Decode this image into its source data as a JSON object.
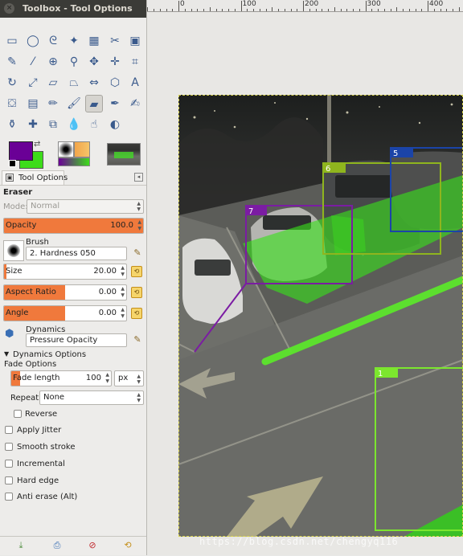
{
  "window": {
    "title": "Toolbox - Tool Options",
    "close_glyph": "×"
  },
  "tools": [
    {
      "icon": "rect-select-icon",
      "glyph": "▭"
    },
    {
      "icon": "ellipse-select-icon",
      "glyph": "◯"
    },
    {
      "icon": "free-select-icon",
      "glyph": "ᘓ"
    },
    {
      "icon": "fuzzy-select-icon",
      "glyph": "✦"
    },
    {
      "icon": "color-select-icon",
      "glyph": "▦"
    },
    {
      "icon": "scissors-icon",
      "glyph": "✂"
    },
    {
      "icon": "foreground-select-icon",
      "glyph": "▣"
    },
    {
      "icon": "paths-icon",
      "glyph": "✎"
    },
    {
      "icon": "color-picker-icon",
      "glyph": "⁄"
    },
    {
      "icon": "zoom-icon",
      "glyph": "⊕"
    },
    {
      "icon": "measure-icon",
      "glyph": "⚲"
    },
    {
      "icon": "move-icon",
      "glyph": "✥"
    },
    {
      "icon": "align-icon",
      "glyph": "✛"
    },
    {
      "icon": "crop-icon",
      "glyph": "⌗"
    },
    {
      "icon": "rotate-icon",
      "glyph": "↻"
    },
    {
      "icon": "scale-icon",
      "glyph": "⤢"
    },
    {
      "icon": "shear-icon",
      "glyph": "▱"
    },
    {
      "icon": "perspective-icon",
      "glyph": "⏢"
    },
    {
      "icon": "flip-icon",
      "glyph": "⇔"
    },
    {
      "icon": "cage-icon",
      "glyph": "⬡"
    },
    {
      "icon": "text-icon",
      "glyph": "A"
    },
    {
      "icon": "bucket-fill-icon",
      "glyph": "⛋"
    },
    {
      "icon": "blend-icon",
      "glyph": "▤"
    },
    {
      "icon": "pencil-icon",
      "glyph": "✏"
    },
    {
      "icon": "paintbrush-icon",
      "glyph": "🖌"
    },
    {
      "icon": "eraser-icon",
      "glyph": "▰"
    },
    {
      "icon": "airbrush-icon",
      "glyph": "✒"
    },
    {
      "icon": "ink-icon",
      "glyph": "✍"
    },
    {
      "icon": "clone-icon",
      "glyph": "⚱"
    },
    {
      "icon": "heal-icon",
      "glyph": "✚"
    },
    {
      "icon": "perspective-clone-icon",
      "glyph": "⧉"
    },
    {
      "icon": "blur-icon",
      "glyph": "💧"
    },
    {
      "icon": "smudge-icon",
      "glyph": "☝"
    },
    {
      "icon": "dodge-burn-icon",
      "glyph": "◐"
    }
  ],
  "colors": {
    "foreground": "#6a0096",
    "background": "#3ddc1a",
    "accent": "#f0793c"
  },
  "tab": {
    "label": "Tool Options",
    "menu_glyph": "◂"
  },
  "options": {
    "tool_name": "Eraser",
    "mode_label": "Mode:",
    "mode_value": "Normal",
    "opacity": {
      "label": "Opacity",
      "value": "100.0",
      "fraction": 1.0
    },
    "brush": {
      "label": "Brush",
      "value": "2. Hardness 050"
    },
    "size": {
      "label": "Size",
      "value": "20.00",
      "fraction": 0.02
    },
    "aspect_ratio": {
      "label": "Aspect Ratio",
      "value": "0.00",
      "fraction": 0.5
    },
    "angle": {
      "label": "Angle",
      "value": "0.00",
      "fraction": 0.5
    },
    "dynamics": {
      "label": "Dynamics",
      "value": "Pressure Opacity"
    },
    "dynamics_options": "Dynamics Options",
    "fade_options": "Fade Options",
    "fade_length": {
      "label": "Fade length",
      "value": "100",
      "unit": "px",
      "fraction": 0.09
    },
    "repeat": {
      "label": "Repeat:",
      "value": "None"
    },
    "reverse": "Reverse",
    "apply_jitter": "Apply Jitter",
    "smooth_stroke": "Smooth stroke",
    "incremental": "Incremental",
    "hard_edge": "Hard edge",
    "anti_erase": "Anti erase  (Alt)"
  },
  "ruler": {
    "labels": [
      "0",
      "100",
      "200",
      "300",
      "400"
    ]
  },
  "boxes": [
    {
      "id": "7",
      "color": "#7b1ca3"
    },
    {
      "id": "6",
      "color": "#8fb51e"
    },
    {
      "id": "5",
      "color": "#1b44a8"
    },
    {
      "id": "1",
      "color": "#7ce62e"
    }
  ],
  "watermark": "https://blog.csdn.net/chengyq116"
}
